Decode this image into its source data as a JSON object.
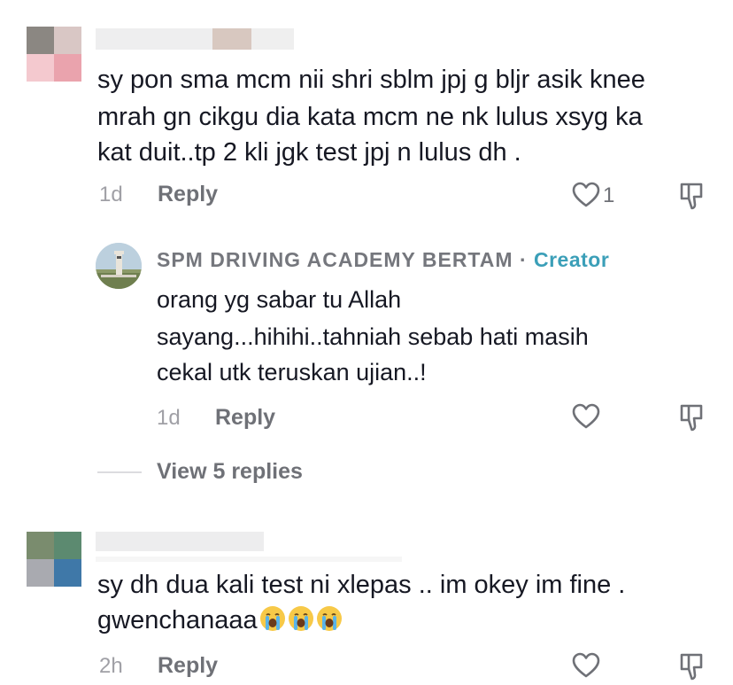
{
  "comments": [
    {
      "text_lines": [
        "sy pon sma mcm nii shri sblm jpj g bljr asik knee",
        "mrah gn cikgu dia kata mcm ne nk lulus xsyg ka",
        "kat duit..tp 2 kli jgk test jpj n lulus dh ."
      ],
      "time": "1d",
      "reply_label": "Reply",
      "like_count": "1",
      "reply": {
        "username": "SPM DRIVING ACADEMY BERTAM",
        "separator": "·",
        "badge": "Creator",
        "text_lines": [
          "orang yg sabar tu Allah",
          "sayang...hihihi..tahniah sebab hati masih",
          "cekal utk teruskan ujian..!"
        ],
        "time": "1d",
        "reply_label": "Reply"
      },
      "view_replies": "View 5 replies"
    },
    {
      "text_lines": [
        "sy dh dua kali test ni xlepas .. im okey im fine .",
        "gwenchanaaa"
      ],
      "emojis": [
        "loudly-crying-face",
        "loudly-crying-face",
        "loudly-crying-face"
      ],
      "time": "2h",
      "reply_label": "Reply"
    }
  ],
  "colors": {
    "text": "#161823",
    "secondary": "#6f7177",
    "timestamp": "#a0a0a6",
    "creator_accent": "#3b9fb8"
  }
}
